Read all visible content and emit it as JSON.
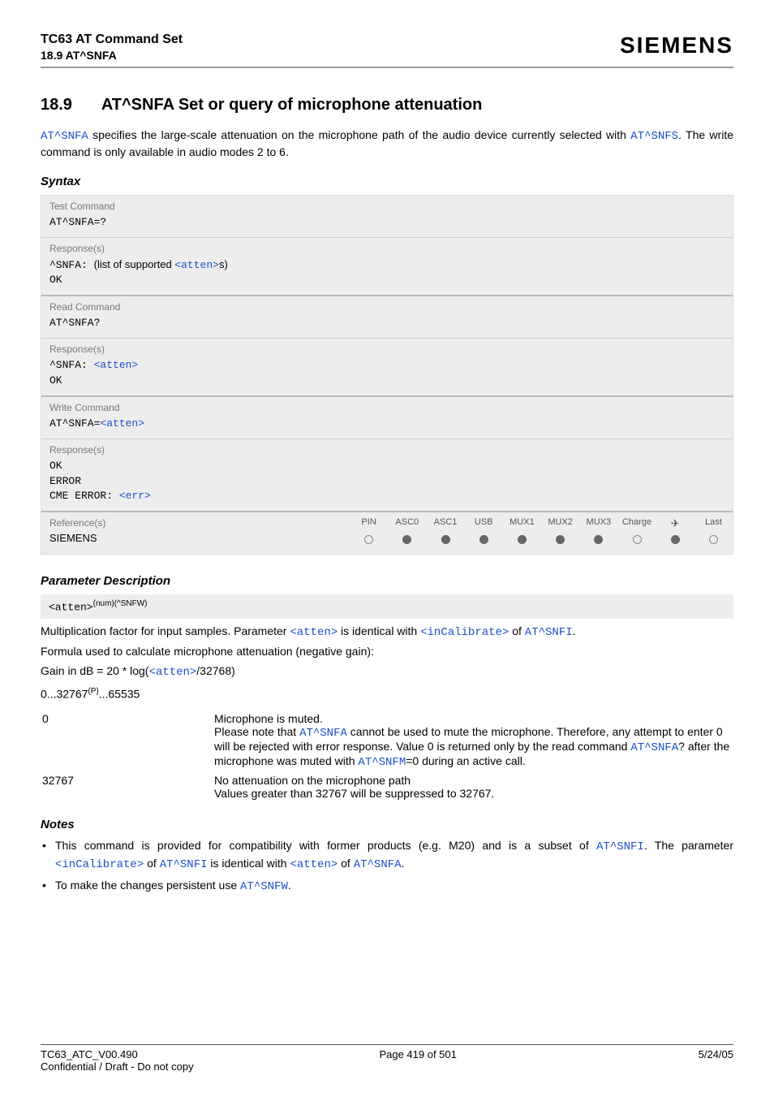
{
  "header": {
    "doc_title": "TC63 AT Command Set",
    "doc_section": "18.9 AT^SNFA",
    "brand": "SIEMENS"
  },
  "section": {
    "number": "18.9",
    "title": "AT^SNFA   Set or query of microphone attenuation"
  },
  "intro": {
    "cmd1": "AT^SNFA",
    "text1": " specifies the large-scale attenuation on the microphone path of the audio device currently selected with ",
    "cmd2": "AT^SNFS",
    "text2": ". The write command is only available in audio modes 2 to 6."
  },
  "syntax": {
    "heading": "Syntax",
    "test": {
      "label": "Test Command",
      "cmd": "AT^SNFA=?"
    },
    "test_resp": {
      "label": "Response(s)",
      "prefix": "^SNFA: ",
      "mid": "(list of supported ",
      "param": "<atten>",
      "suffix": "s)",
      "ok": "OK"
    },
    "read": {
      "label": "Read Command",
      "cmd": "AT^SNFA?"
    },
    "read_resp": {
      "label": "Response(s)",
      "prefix": "^SNFA: ",
      "param": "<atten>",
      "ok": "OK"
    },
    "write": {
      "label": "Write Command",
      "prefix": "AT^SNFA=",
      "param": "<atten>"
    },
    "write_resp": {
      "label": "Response(s)",
      "ok": "OK",
      "error": "ERROR",
      "cme_prefix": "CME ERROR: ",
      "cme_param": "<err>"
    },
    "ref": {
      "label": "Reference(s)",
      "value": "SIEMENS",
      "cols": [
        "PIN",
        "ASC0",
        "ASC1",
        "USB",
        "MUX1",
        "MUX2",
        "MUX3",
        "Charge",
        "✈",
        "Last"
      ],
      "dots": [
        "open",
        "filled",
        "filled",
        "filled",
        "filled",
        "filled",
        "filled",
        "open",
        "filled",
        "open"
      ]
    }
  },
  "param_desc": {
    "heading": "Parameter Description",
    "name": "<atten>",
    "sup": "(num)(^SNFW)",
    "line1a": "Multiplication factor for input samples. Parameter ",
    "p1": "<atten>",
    "line1b": " is identical with ",
    "p2": "<inCalibrate>",
    "line1c": " of ",
    "p3": "AT^SNFI",
    "line1d": ".",
    "line2": "Formula used to calculate microphone attenuation (negative gain):",
    "line3a": "Gain in dB = 20 * log(",
    "p4": "<atten>",
    "line3b": "/32768)",
    "range_a": "0...32767",
    "range_sup": "(P)",
    "range_b": "...65535",
    "rows": [
      {
        "key": "0",
        "d1": "Microphone is muted.",
        "d2a": "Please note that ",
        "cmd1": "AT^SNFA",
        "d2b": " cannot be used to mute the microphone. Therefore, any attempt to enter 0 will be rejected with error response. Value 0 is returned only by the read command ",
        "cmd2": "AT^SNFA",
        "d2c": "? after the microphone was muted with ",
        "cmd3": "AT^SNFM",
        "d2d": "=0 during an active call."
      },
      {
        "key": "32767",
        "d1": "No attenuation on the microphone path",
        "d2": "Values greater than 32767 will be suppressed to 32767."
      }
    ]
  },
  "notes": {
    "heading": "Notes",
    "n1a": "This command is provided for compatibility with former products (e.g. M20) and is a subset of ",
    "n1cmd1": "AT^SNFI",
    "n1b": ". The parameter ",
    "n1p1": "<inCalibrate>",
    "n1c": " of ",
    "n1cmd2": "AT^SNFI",
    "n1d": " is identical with ",
    "n1p2": "<atten>",
    "n1e": " of ",
    "n1cmd3": "AT^SNFA",
    "n1f": ".",
    "n2a": "To make the changes persistent use ",
    "n2cmd": "AT^SNFW",
    "n2b": "."
  },
  "footer": {
    "left": "TC63_ATC_V00.490",
    "center": "Page 419 of 501",
    "right": "5/24/05",
    "sub": "Confidential / Draft - Do not copy"
  }
}
